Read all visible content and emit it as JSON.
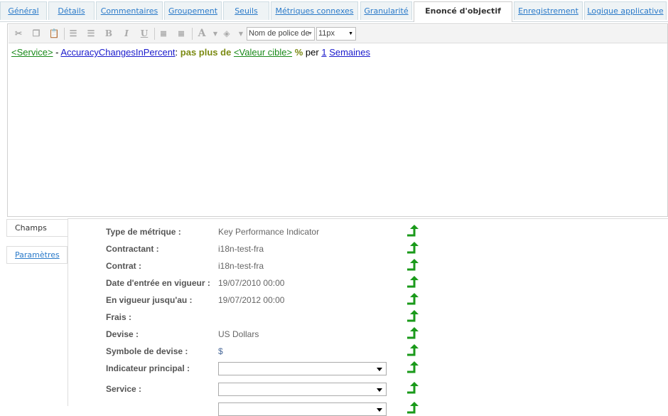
{
  "tabs": [
    "Général",
    "Détails",
    "Commentaires",
    "Groupement",
    "Seuils",
    "Métriques connexes",
    "Granularité",
    "Enoncé d'objectif",
    "Enregistrement",
    "Logique applicative"
  ],
  "active_tab": "Enoncé d'objectif",
  "toolbar": {
    "font_name": "Nom de police de",
    "font_size": "11px",
    "bold": "B",
    "italic": "I",
    "underline": "U",
    "font_color": "A"
  },
  "statement": {
    "service": "<Service>",
    "dash": " - ",
    "metric": "AccuracyChangesInPercent",
    "colon": ": ",
    "condition": "pas plus de",
    "target": "<Valeur cible>",
    "percent": "%",
    "per": "per",
    "count": "1",
    "unit": "Semaines"
  },
  "side_tabs": [
    "Champs",
    "Paramètres"
  ],
  "fields": [
    {
      "label": "Type de métrique :",
      "value": "Key Performance Indicator"
    },
    {
      "label": "Contractant :",
      "value": "i18n-test-fra"
    },
    {
      "label": "Contrat :",
      "value": "i18n-test-fra"
    },
    {
      "label": "Date d'entrée en vigueur :",
      "value": "19/07/2010 00:00"
    },
    {
      "label": "En vigueur jusqu'au :",
      "value": "19/07/2012 00:00"
    },
    {
      "label": "Frais :",
      "value": ""
    },
    {
      "label": "Devise :",
      "value": "US Dollars"
    },
    {
      "label": "Symbole de devise :",
      "value": "$"
    },
    {
      "label": "Indicateur principal :",
      "value": ""
    },
    {
      "label": "Service :",
      "value": ""
    }
  ]
}
